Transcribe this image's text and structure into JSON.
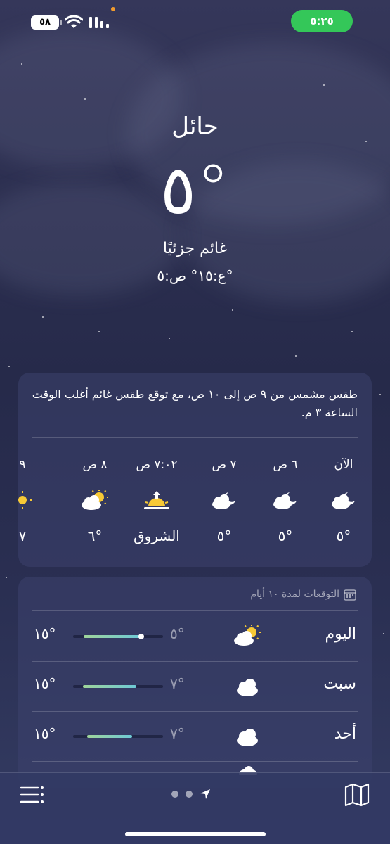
{
  "status_bar": {
    "battery": "٥٨",
    "time": "٥:٢٥"
  },
  "location": {
    "city": "حائل",
    "temperature": "٥°",
    "condition": "غائم جزئيًا",
    "high_low": "ع:١٥°  ص:٥°"
  },
  "hourly": {
    "summary": "طقس مشمس من ٩ ص إلى ١٠ ص، مع توقع طقس غائم أغلب الوقت الساعة ٣ م.",
    "items": [
      {
        "label": "الآن",
        "icon": "partly-cloudy-night-icon",
        "value": "٥°"
      },
      {
        "label": "٦ ص",
        "icon": "partly-cloudy-night-icon",
        "value": "٥°"
      },
      {
        "label": "٧ ص",
        "icon": "partly-cloudy-night-icon",
        "value": "٥°"
      },
      {
        "label": "٧:٠٢ ص",
        "icon": "sunrise-icon",
        "value": "الشروق"
      },
      {
        "label": "٨ ص",
        "icon": "partly-sunny-icon",
        "value": "٦°"
      },
      {
        "label": "٩",
        "icon": "sun-icon",
        "value": "٧"
      }
    ]
  },
  "daily": {
    "title": "التوقعات لمدة ١٠ أيام",
    "days": [
      {
        "name": "اليوم",
        "icon": "partly-sunny-icon",
        "low": "٥°",
        "high": "١٥°",
        "range_start": 0.12,
        "range_end": 0.74,
        "current": 0.76
      },
      {
        "name": "سبت",
        "icon": "cloud-icon",
        "low": "٧°",
        "high": "١٥°",
        "range_start": 0.11,
        "range_end": 0.7
      },
      {
        "name": "أحد",
        "icon": "cloud-icon",
        "low": "٧°",
        "high": "١٥°",
        "range_start": 0.16,
        "range_end": 0.66
      }
    ]
  },
  "colors": {
    "accent_green": "#34c759",
    "temp_bar_start": "#9fd49a",
    "temp_bar_end": "#6ec9d6",
    "sun": "#f7c936"
  }
}
